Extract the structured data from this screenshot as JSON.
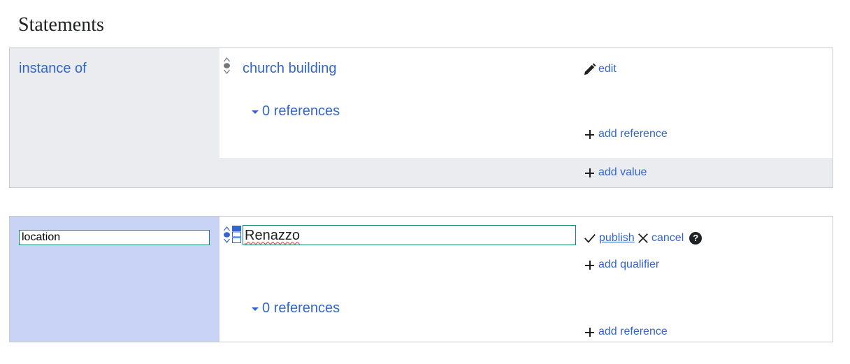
{
  "section_title": "Statements",
  "statement_1": {
    "property_label": "instance of",
    "value_label": "church building",
    "edit_label": "edit",
    "references_toggle_label": "0 references",
    "add_reference_label": "add reference",
    "add_value_label": "add value"
  },
  "statement_2": {
    "property_input_value": "location",
    "value_input_value": "Renazzo",
    "publish_label": "publish",
    "cancel_label": "cancel",
    "help_symbol": "?",
    "add_qualifier_label": "add qualifier",
    "references_toggle_label": "0 references",
    "add_reference_label": "add reference"
  },
  "colors": {
    "link": "#3366cc",
    "property_bg": "#eaecf0",
    "property_bg_editing": "#c8d3f5",
    "border": "#c8ccd1",
    "input_border": "#14866d"
  },
  "icons": {
    "rank": "rank-normal-icon",
    "snak_type": "snak-type-selector-icon",
    "edit": "pencil-icon",
    "add": "plus-icon",
    "publish": "checkmark-icon",
    "cancel": "close-icon",
    "help": "help-icon"
  }
}
